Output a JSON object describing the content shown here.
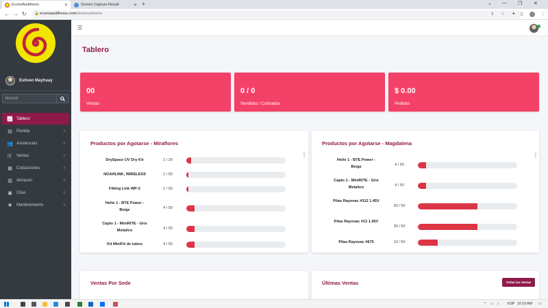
{
  "browser": {
    "tabs": [
      {
        "label": "EconoAudifonos",
        "active": true
      },
      {
        "label": "Screen Capture Result",
        "active": false
      }
    ],
    "new_tab_glyph": "+",
    "url_host": "econoaudifonos.com",
    "url_path": "/sistema/home",
    "window_controls": [
      "⌄",
      "—",
      "❐",
      "✕"
    ]
  },
  "sidebar": {
    "user_name": "Estiven Mayhuay",
    "search_placeholder": "Buscar",
    "items": [
      {
        "label": "Tablero",
        "icon": "chart-area-icon",
        "glyph": "📈",
        "active": true,
        "has_submenu": false
      },
      {
        "label": "Planilla",
        "icon": "file-icon",
        "glyph": "▤",
        "active": false,
        "has_submenu": true
      },
      {
        "label": "Asistencias",
        "icon": "users-icon",
        "glyph": "👥",
        "active": false,
        "has_submenu": true
      },
      {
        "label": "Ventas",
        "icon": "cart-icon",
        "glyph": "🛒",
        "active": false,
        "has_submenu": true
      },
      {
        "label": "Cotizaciones",
        "icon": "documents-icon",
        "glyph": "▦",
        "active": false,
        "has_submenu": true
      },
      {
        "label": "Almacen",
        "icon": "warehouse-icon",
        "glyph": "▥",
        "active": false,
        "has_submenu": true
      },
      {
        "label": "Citas",
        "icon": "calendar-icon",
        "glyph": "▣",
        "active": false,
        "has_submenu": true
      },
      {
        "label": "Mantenimiento",
        "icon": "tools-icon",
        "glyph": "✖",
        "active": false,
        "has_submenu": true
      }
    ]
  },
  "page": {
    "title": "Tablero"
  },
  "stats": [
    {
      "value": "00",
      "label": "Ventas"
    },
    {
      "value": "0 / 0",
      "label": "Vendidos / Cotizados"
    },
    {
      "value": "$ 0.00",
      "label": "Pedidos"
    }
  ],
  "products_miraflores": {
    "title": "Productos por Agotarse - Miraflores",
    "rows": [
      {
        "name": "DrySpace UV Dry Kit",
        "qty": "1 / 20",
        "fraction": 0.05
      },
      {
        "name": "NOAHLINK, WIRELESS",
        "qty": "1 / 50",
        "fraction": 0.02
      },
      {
        "name": "Fitting Link WP-2",
        "qty": "1 / 50",
        "fraction": 0.02
      },
      {
        "name": "Helio 1 - BTE Power - Beige",
        "qty": "4 / 50",
        "fraction": 0.08
      },
      {
        "name": "Capto 1 - MiniRITE - Gris Metalico",
        "qty": "4 / 50",
        "fraction": 0.08
      },
      {
        "name": "Kit MiniFit de tubos",
        "qty": "4 / 50",
        "fraction": 0.08
      }
    ]
  },
  "products_magdalena": {
    "title": "Productos por Agotarse - Magdalena",
    "rows": [
      {
        "name": "Helio 1 - BTE Power - Beige",
        "qty": "4 / 50",
        "fraction": 0.08
      },
      {
        "name": "Capto 1 - MiniRITE - Gris Metalico",
        "qty": "4 / 50",
        "fraction": 0.08
      },
      {
        "name": "Pilas Rayovac #312 1.45V",
        "qty": "30 / 50",
        "fraction": 0.6
      },
      {
        "name": "Pilas Rayovac #13 1.45V",
        "qty": "30 / 50",
        "fraction": 0.6
      },
      {
        "name": "Pilas Rayovac #675",
        "qty": "10 / 50",
        "fraction": 0.2
      }
    ]
  },
  "sales_by_branch": {
    "title": "Ventas Por Sede"
  },
  "latest_sales": {
    "title": "Últimas Ventas",
    "button_label": "Todas las Ventas"
  },
  "taskbar": {
    "language": "ESP",
    "time": "10:10 AM"
  },
  "colors": {
    "brand": "#8e1a4a",
    "stat_card": "#f44168",
    "progress": "#dc3545",
    "sidebar": "#343a40"
  }
}
